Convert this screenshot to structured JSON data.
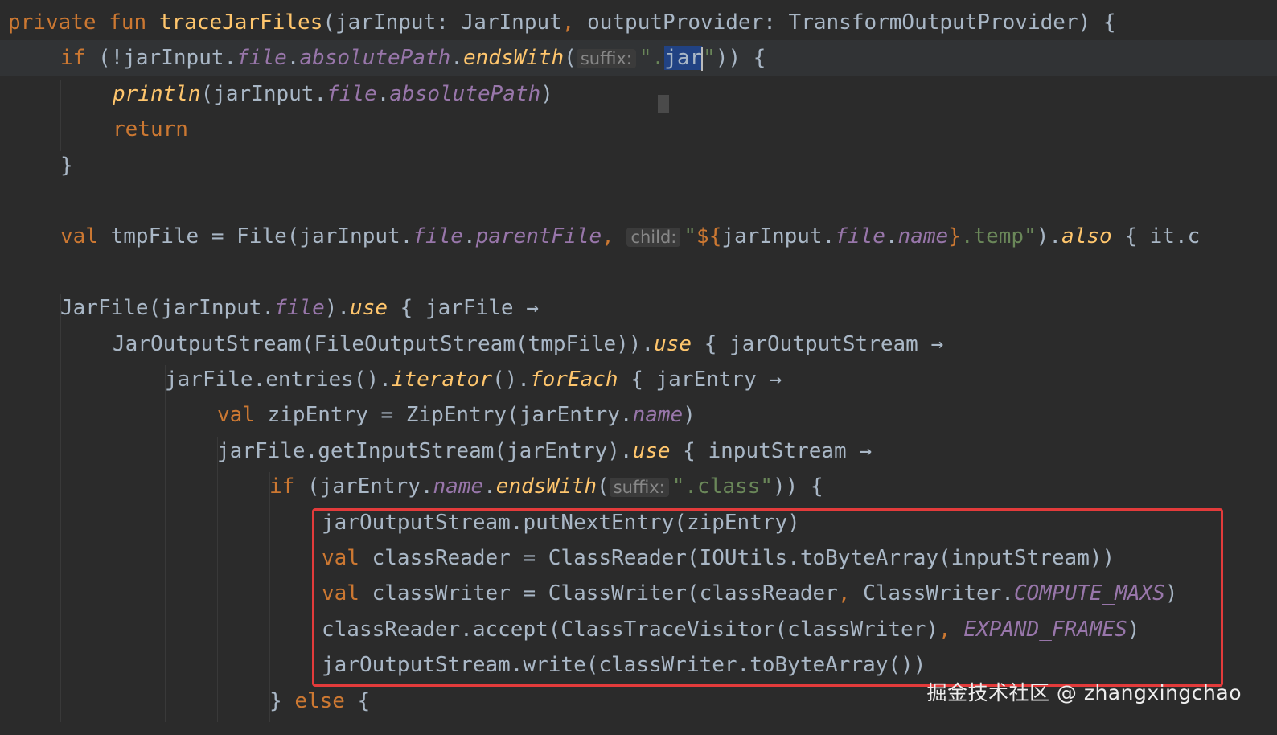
{
  "code": {
    "lines": [
      {
        "indent": 0,
        "tokens": [
          {
            "t": "private ",
            "c": "kw"
          },
          {
            "t": "fun ",
            "c": "kw"
          },
          {
            "t": "traceJarFiles",
            "c": "fn"
          },
          {
            "t": "(jarInput: JarInput",
            "c": "plain"
          },
          {
            "t": ", ",
            "c": "kw"
          },
          {
            "t": "outputProvider: TransformOutputProvider) {",
            "c": "plain"
          }
        ]
      },
      {
        "indent": 1,
        "current": true,
        "tokens": [
          {
            "t": "if ",
            "c": "kw"
          },
          {
            "t": "(!jarInput.",
            "c": "plain"
          },
          {
            "t": "file",
            "c": "prop"
          },
          {
            "t": ".",
            "c": "plain"
          },
          {
            "t": "absolutePath",
            "c": "prop"
          },
          {
            "t": ".",
            "c": "plain"
          },
          {
            "t": "endsWith",
            "c": "ext"
          },
          {
            "t": "(",
            "c": "plain"
          },
          {
            "t": "suffix:",
            "c": "hint"
          },
          {
            "t": "\".",
            "c": "str"
          },
          {
            "t": "jar",
            "c": "sel"
          },
          {
            "t": "",
            "c": "caret"
          },
          {
            "t": "\"",
            "c": "str"
          },
          {
            "t": ")) {",
            "c": "plain"
          }
        ]
      },
      {
        "indent": 2,
        "tokens": [
          {
            "t": "println",
            "c": "ext"
          },
          {
            "t": "(jarInput.",
            "c": "plain"
          },
          {
            "t": "file",
            "c": "prop"
          },
          {
            "t": ".",
            "c": "plain"
          },
          {
            "t": "absolutePath",
            "c": "prop"
          },
          {
            "t": ")",
            "c": "plain"
          }
        ]
      },
      {
        "indent": 2,
        "tokens": [
          {
            "t": "return",
            "c": "kw"
          }
        ]
      },
      {
        "indent": 1,
        "tokens": [
          {
            "t": "}",
            "c": "plain"
          }
        ]
      },
      {
        "indent": 0,
        "tokens": []
      },
      {
        "indent": 1,
        "tokens": [
          {
            "t": "val ",
            "c": "kw"
          },
          {
            "t": "tmpFile = File(jarInput.",
            "c": "plain"
          },
          {
            "t": "file",
            "c": "prop"
          },
          {
            "t": ".",
            "c": "plain"
          },
          {
            "t": "parentFile",
            "c": "prop"
          },
          {
            "t": ", ",
            "c": "kw"
          },
          {
            "t": "child:",
            "c": "hint"
          },
          {
            "t": "\"",
            "c": "str"
          },
          {
            "t": "${",
            "c": "kw"
          },
          {
            "t": "jarInput.",
            "c": "plain"
          },
          {
            "t": "file",
            "c": "prop"
          },
          {
            "t": ".",
            "c": "plain"
          },
          {
            "t": "name",
            "c": "prop"
          },
          {
            "t": "}",
            "c": "kw"
          },
          {
            "t": ".temp\"",
            "c": "str"
          },
          {
            "t": ").",
            "c": "plain"
          },
          {
            "t": "also",
            "c": "ext"
          },
          {
            "t": " { it.c",
            "c": "plain"
          }
        ]
      },
      {
        "indent": 0,
        "tokens": []
      },
      {
        "indent": 1,
        "tokens": [
          {
            "t": "JarFile(jarInput.",
            "c": "plain"
          },
          {
            "t": "file",
            "c": "prop"
          },
          {
            "t": ").",
            "c": "plain"
          },
          {
            "t": "use",
            "c": "ext"
          },
          {
            "t": " { jarFile →",
            "c": "plain"
          }
        ]
      },
      {
        "indent": 2,
        "tokens": [
          {
            "t": "JarOutputStream(FileOutputStream(tmpFile)).",
            "c": "plain"
          },
          {
            "t": "use",
            "c": "ext"
          },
          {
            "t": " { jarOutputStream →",
            "c": "plain"
          }
        ]
      },
      {
        "indent": 3,
        "tokens": [
          {
            "t": "jarFile.entries().",
            "c": "plain"
          },
          {
            "t": "iterator",
            "c": "ext"
          },
          {
            "t": "().",
            "c": "plain"
          },
          {
            "t": "forEach",
            "c": "ext"
          },
          {
            "t": " { jarEntry →",
            "c": "plain"
          }
        ]
      },
      {
        "indent": 4,
        "tokens": [
          {
            "t": "val ",
            "c": "kw"
          },
          {
            "t": "zipEntry = ZipEntry(jarEntry.",
            "c": "plain"
          },
          {
            "t": "name",
            "c": "prop"
          },
          {
            "t": ")",
            "c": "plain"
          }
        ]
      },
      {
        "indent": 4,
        "tokens": [
          {
            "t": "jarFile.getInputStream(jarEntry).",
            "c": "plain"
          },
          {
            "t": "use",
            "c": "ext"
          },
          {
            "t": " { inputStream →",
            "c": "plain"
          }
        ]
      },
      {
        "indent": 5,
        "tokens": [
          {
            "t": "if ",
            "c": "kw"
          },
          {
            "t": "(jarEntry.",
            "c": "plain"
          },
          {
            "t": "name",
            "c": "prop"
          },
          {
            "t": ".",
            "c": "plain"
          },
          {
            "t": "endsWith",
            "c": "ext"
          },
          {
            "t": "(",
            "c": "plain"
          },
          {
            "t": "suffix:",
            "c": "hint"
          },
          {
            "t": "\".class\"",
            "c": "str"
          },
          {
            "t": ")) {",
            "c": "plain"
          }
        ]
      },
      {
        "indent": 6,
        "tokens": [
          {
            "t": "jarOutputStream.putNextEntry(zipEntry)",
            "c": "plain"
          }
        ]
      },
      {
        "indent": 6,
        "tokens": [
          {
            "t": "val ",
            "c": "kw"
          },
          {
            "t": "classReader = ClassReader(IOUtils.toByteArray(inputStream))",
            "c": "plain"
          }
        ]
      },
      {
        "indent": 6,
        "tokens": [
          {
            "t": "val ",
            "c": "kw"
          },
          {
            "t": "classWriter = ClassWriter(classReader",
            "c": "plain"
          },
          {
            "t": ", ",
            "c": "kw"
          },
          {
            "t": "ClassWriter.",
            "c": "plain"
          },
          {
            "t": "COMPUTE_MAXS",
            "c": "const"
          },
          {
            "t": ")",
            "c": "plain"
          }
        ]
      },
      {
        "indent": 6,
        "tokens": [
          {
            "t": "classReader.accept(ClassTraceVisitor(classWriter)",
            "c": "plain"
          },
          {
            "t": ", ",
            "c": "kw"
          },
          {
            "t": "EXPAND_FRAMES",
            "c": "const"
          },
          {
            "t": ")",
            "c": "plain"
          }
        ]
      },
      {
        "indent": 6,
        "tokens": [
          {
            "t": "jarOutputStream.write(classWriter.toByteArray())",
            "c": "plain"
          }
        ]
      },
      {
        "indent": 5,
        "tokens": [
          {
            "t": "} ",
            "c": "plain"
          },
          {
            "t": "else ",
            "c": "kw"
          },
          {
            "t": "{",
            "c": "plain"
          }
        ]
      }
    ]
  },
  "colors": {
    "background": "#2b2b2b",
    "keyword": "#cc7832",
    "function": "#ffc66d",
    "property": "#9876aa",
    "string": "#6a8759",
    "text": "#a9b7c6",
    "highlight_box": "#e33b3b"
  },
  "watermark": "掘金技术社区 @ zhangxingchao"
}
